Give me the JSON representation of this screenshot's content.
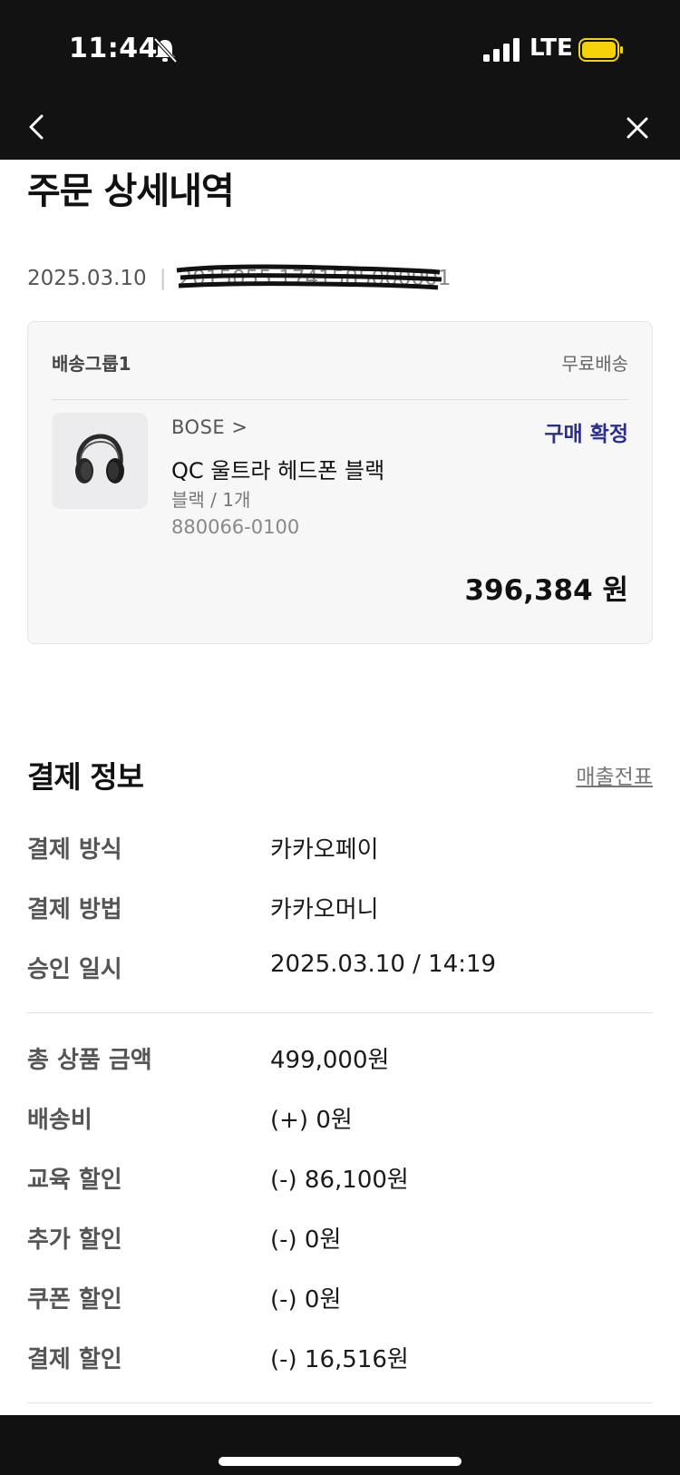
{
  "status_bar": {
    "time": "11:44",
    "network": "LTE"
  },
  "nav": {
    "back_icon": "chevron-left-icon",
    "close_icon": "close-icon"
  },
  "page_title": "주문 상세내역",
  "order": {
    "date": "2025.03.10",
    "separator": "|",
    "number": "2015055 1741585000001"
  },
  "delivery_group": {
    "label": "배송그룹1",
    "shipping": "무료배송",
    "item": {
      "brand": "BOSE",
      "brand_chevron": ">",
      "status": "구매 확정",
      "name": "QC 울트라 헤드폰 블랙",
      "option": "블랙 / 1개",
      "code": "880066-0100",
      "price": "396,384 원"
    }
  },
  "payment": {
    "title": "결제 정보",
    "receipt_link": "매출전표",
    "method_rows": [
      {
        "label": "결제 방식",
        "value": "카카오페이"
      },
      {
        "label": "결제 방법",
        "value": "카카오머니"
      },
      {
        "label": "승인 일시",
        "value": "2025.03.10 / 14:19"
      }
    ],
    "amount_rows": [
      {
        "label": "총 상품 금액",
        "value": "499,000원"
      },
      {
        "label": "배송비",
        "value": "(+) 0원"
      },
      {
        "label": "교육 할인",
        "value": "(-) 86,100원"
      },
      {
        "label": "추가 할인",
        "value": "(-) 0원"
      },
      {
        "label": "쿠폰 할인",
        "value": "(-) 0원"
      },
      {
        "label": "결제 할인",
        "value": "(-) 16,516원"
      }
    ]
  },
  "colors": {
    "accent": "#2c2f8c",
    "topbar": "#121212",
    "battery": "#f5d20a"
  }
}
